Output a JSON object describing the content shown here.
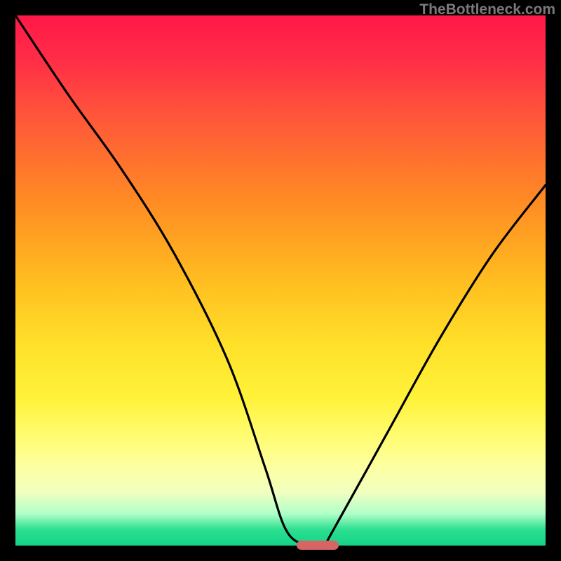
{
  "watermark": "TheBottleneck.com",
  "colors": {
    "gradient_top": "#ff1848",
    "gradient_bottom": "#15d388",
    "curve_stroke": "#000000",
    "marker_fill": "#d86464",
    "frame_bg": "#000000"
  },
  "chart_data": {
    "type": "line",
    "title": "",
    "xlabel": "",
    "ylabel": "",
    "xlim": [
      0,
      100
    ],
    "ylim": [
      0,
      100
    ],
    "x": [
      0,
      10,
      20,
      30,
      40,
      47,
      51,
      55,
      58,
      60,
      70,
      80,
      90,
      100
    ],
    "values": [
      100,
      85,
      71,
      55,
      35,
      15,
      3,
      0,
      0,
      3,
      21,
      39,
      55,
      68
    ],
    "marker": {
      "x_start": 53,
      "x_end": 61,
      "y": 0
    },
    "grid": false,
    "legend": false
  }
}
